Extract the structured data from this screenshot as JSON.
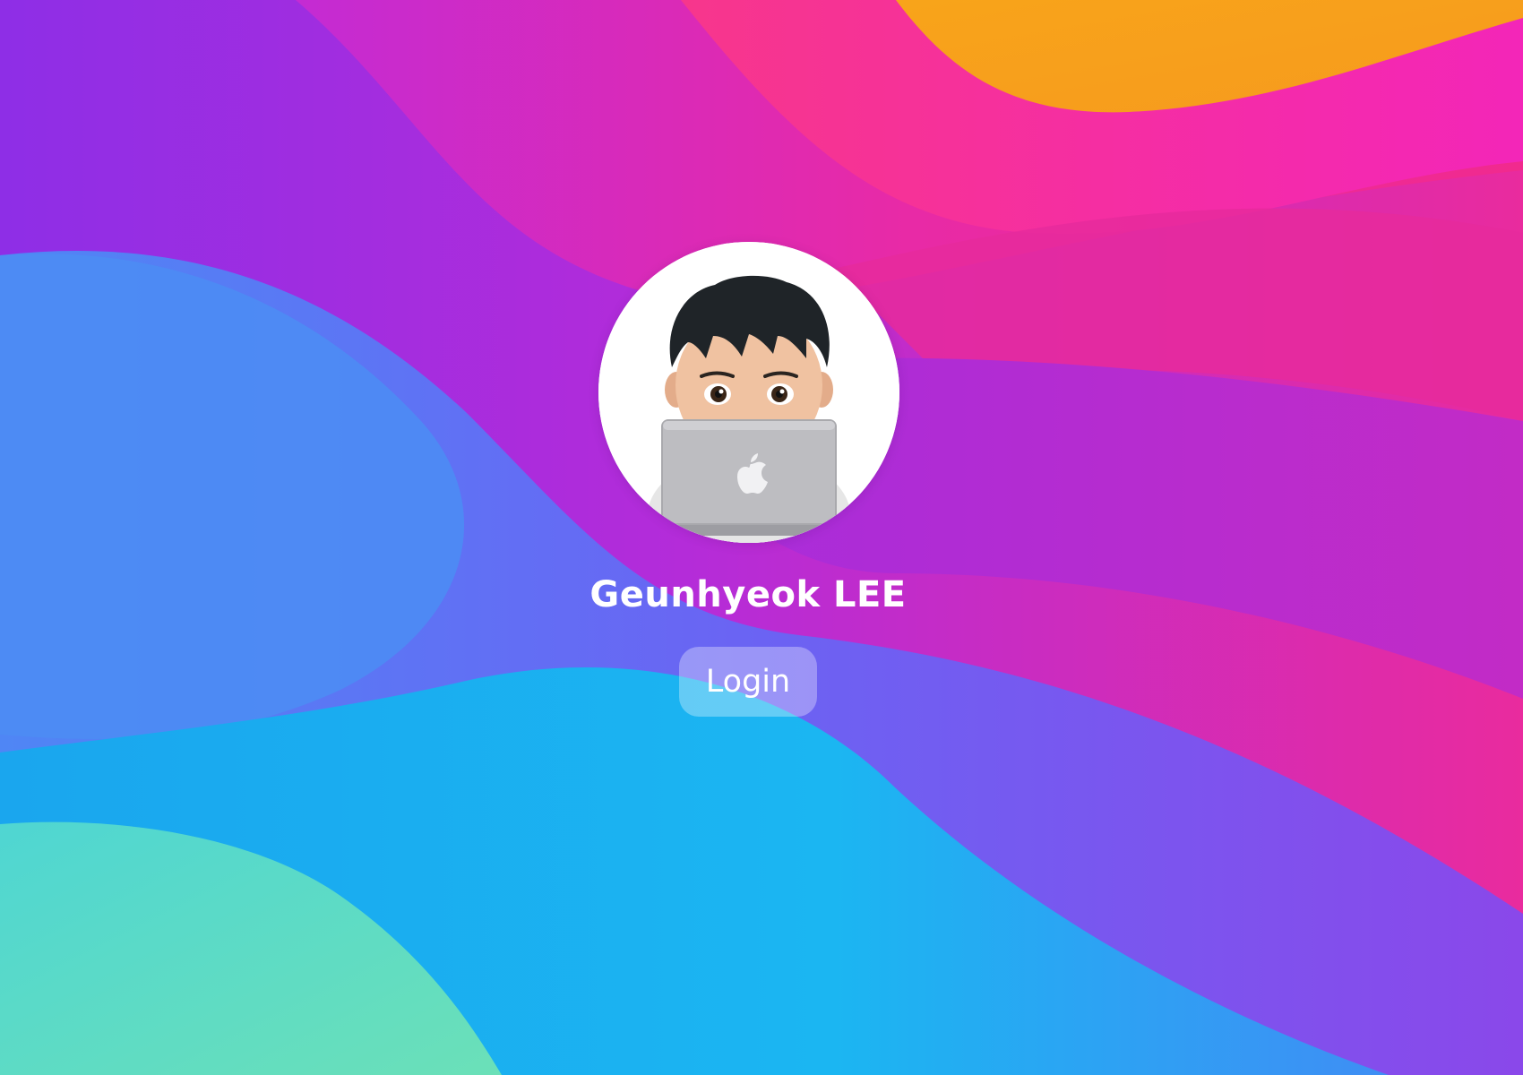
{
  "background": {
    "name": "wallpaper",
    "colors": [
      "#9b30e6",
      "#e02aa8",
      "#f7a51c",
      "#5c78f7",
      "#19b6f2",
      "#5fdcc0"
    ]
  },
  "user": {
    "name": "Geunhyeok LEE",
    "avatar_icon": "memoji-laptop-icon"
  },
  "login": {
    "label": "Login"
  }
}
